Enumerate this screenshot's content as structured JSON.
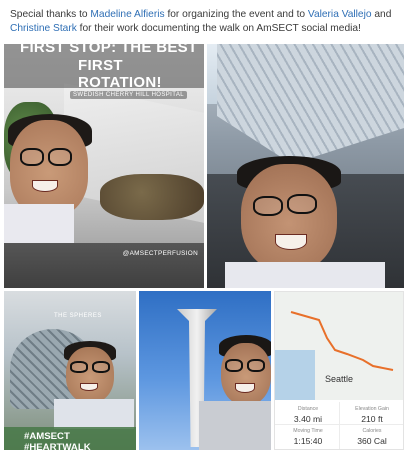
{
  "caption": {
    "part1": "Special thanks to ",
    "mention1": "Madeline Alfieris",
    "part2": " for organizing the event and to ",
    "mention2": "Valeria Vallejo",
    "part3": " and ",
    "mention3": "Christine Stark",
    "part4": " for their work documenting the walk on AmSECT social media!"
  },
  "photo1": {
    "banner_line1": "FIRST STOP: THE BEST",
    "banner_line2": "FIRST ROTATION!",
    "location_sticker": "SWEDISH CHERRY HILL HOSPITAL",
    "handle": "@AMSECTPERFUSION"
  },
  "photo3": {
    "label": "THE SPHERES",
    "hashtags": "#AMSECT #HEARTWALK"
  },
  "map_card": {
    "city": "Seattle",
    "stats": [
      {
        "label": "Distance",
        "value": "3.40 mi"
      },
      {
        "label": "Elevation Gain",
        "value": "210 ft"
      },
      {
        "label": "Moving Time",
        "value": "1:15:40"
      },
      {
        "label": "Calories",
        "value": "360 Cal"
      }
    ],
    "route_color": "#e8702a"
  },
  "colors": {
    "mention": "#2f6fb5",
    "text": "#3a3a3a"
  }
}
